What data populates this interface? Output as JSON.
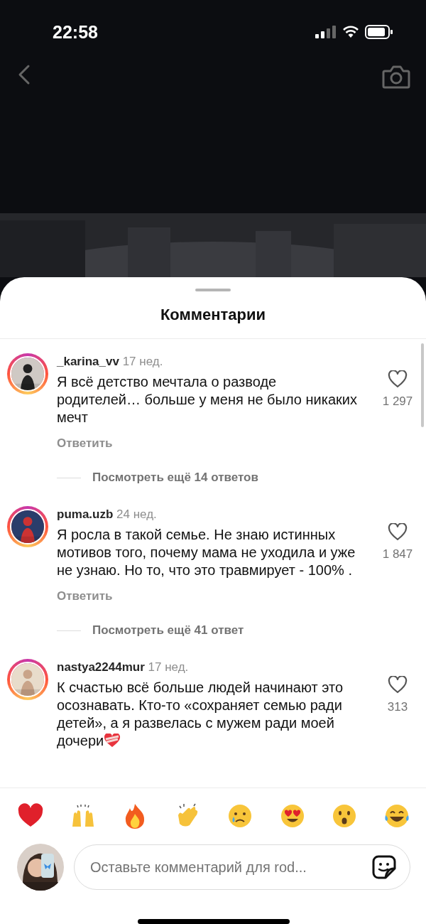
{
  "status_bar": {
    "time": "22:58"
  },
  "sheet": {
    "title": "Комментарии"
  },
  "comments": [
    {
      "username": "_karina_vv",
      "age": "17 нед.",
      "text": "Я всё детство мечтала о разводе родителей… больше у меня не было никаких мечт",
      "likes": "1 297",
      "liked": false,
      "reply": "Ответить",
      "more_replies": "Посмотреть ещё 14 ответов"
    },
    {
      "username": "puma.uzb",
      "age": "24 нед.",
      "text": "Я росла в такой семье. Не знаю истинных мотивов того, почему мама не уходила и уже не узнаю. Но то, что это травмирует - 100% .",
      "likes": "1 847",
      "liked": false,
      "reply": "Ответить",
      "more_replies": "Посмотреть ещё 41 ответ"
    },
    {
      "username": "nastya2244mur",
      "age": "17 нед.",
      "text": "К счастью всё больше людей начинают это осознавать. Кто-то «сохраняет семью ради детей», а я развелась с мужем ради моей дочери",
      "heart_icon": true,
      "likes": "313",
      "liked": false
    }
  ],
  "reactions": [
    {
      "kind": "heart"
    },
    {
      "kind": "raised-hands"
    },
    {
      "kind": "fire"
    },
    {
      "kind": "clap"
    },
    {
      "kind": "crying"
    },
    {
      "kind": "heart-eyes"
    },
    {
      "kind": "surprised"
    },
    {
      "kind": "laughing"
    }
  ],
  "composer": {
    "placeholder": "Оставьте комментарий для rod..."
  }
}
